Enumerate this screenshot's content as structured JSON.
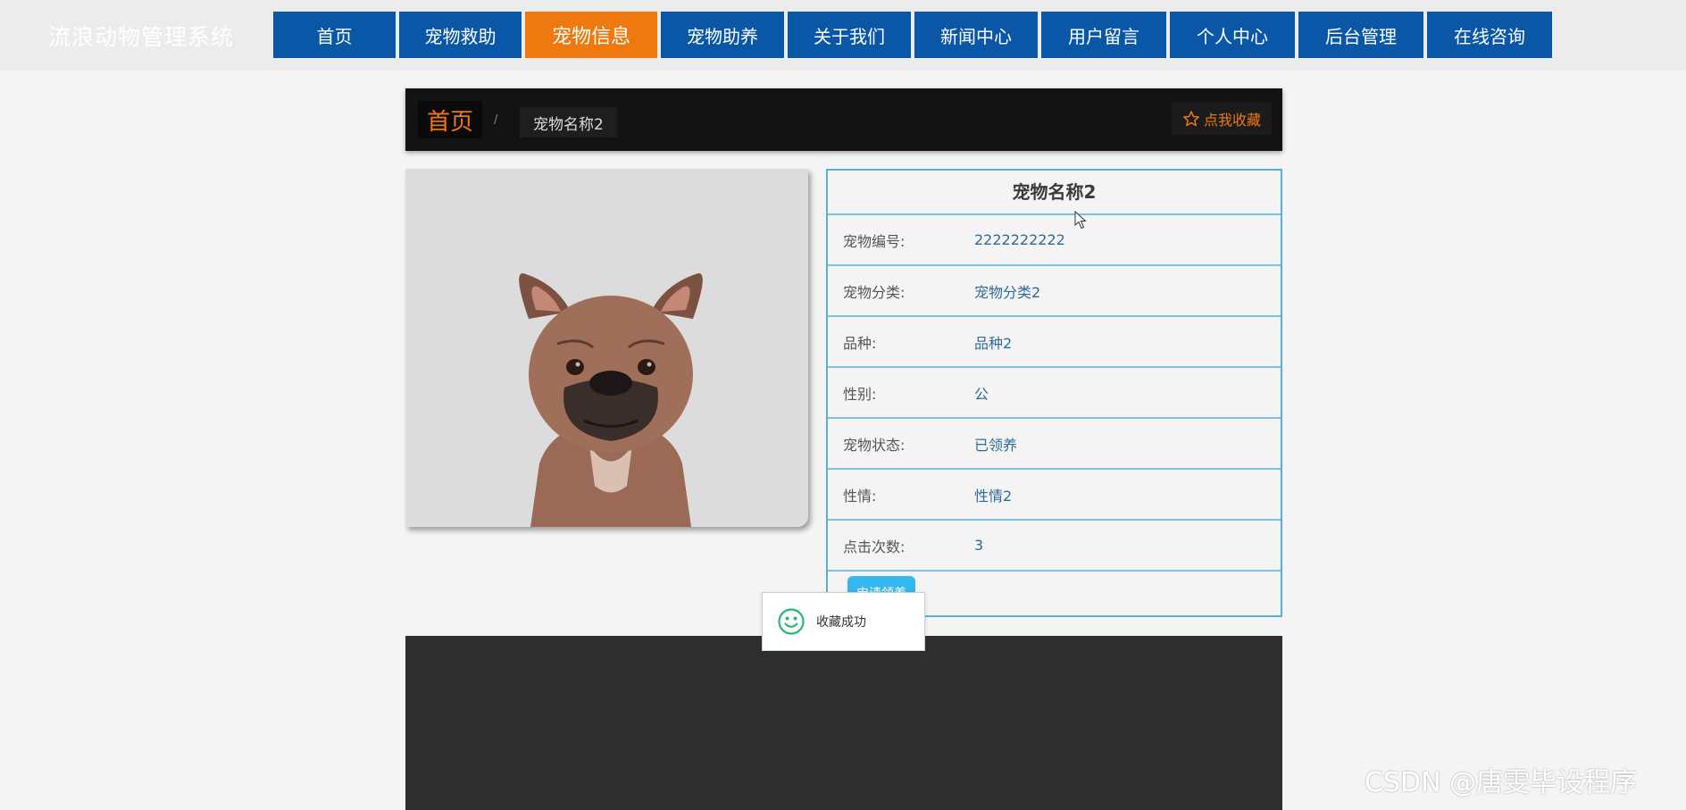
{
  "site": {
    "title": "流浪动物管理系统"
  },
  "nav": {
    "items": [
      {
        "label": "首页"
      },
      {
        "label": "宠物救助"
      },
      {
        "label": "宠物信息"
      },
      {
        "label": "宠物助养"
      },
      {
        "label": "关于我们"
      },
      {
        "label": "新闻中心"
      },
      {
        "label": "用户留言"
      },
      {
        "label": "个人中心"
      },
      {
        "label": "后台管理"
      },
      {
        "label": "在线咨询"
      }
    ],
    "active": "宠物信息"
  },
  "breadcrumb": {
    "home": "首页",
    "separator": "/",
    "current": "宠物名称2"
  },
  "favorite": {
    "label": "点我收藏",
    "icon": "star-icon"
  },
  "pet": {
    "name": "宠物名称2",
    "fields": [
      {
        "label": "宠物编号:",
        "value": "2222222222"
      },
      {
        "label": "宠物分类:",
        "value": "宠物分类2"
      },
      {
        "label": "品种:",
        "value": "品种2"
      },
      {
        "label": "性别:",
        "value": "公"
      },
      {
        "label": "宠物状态:",
        "value": "已领养"
      },
      {
        "label": "性情:",
        "value": "性情2"
      },
      {
        "label": "点击次数:",
        "value": "3"
      }
    ],
    "apply_label": "申请领养"
  },
  "toast": {
    "message": "收藏成功",
    "icon": "smile-icon"
  },
  "watermark": "CSDN @唐雯毕设程序",
  "colors": {
    "nav_bg": "#0a57a8",
    "nav_active": "#f0790f",
    "accent_orange": "#f0790f",
    "border_blue": "#7cc3e3",
    "button_blue": "#35b8ee",
    "toast_icon": "#2bb673"
  }
}
